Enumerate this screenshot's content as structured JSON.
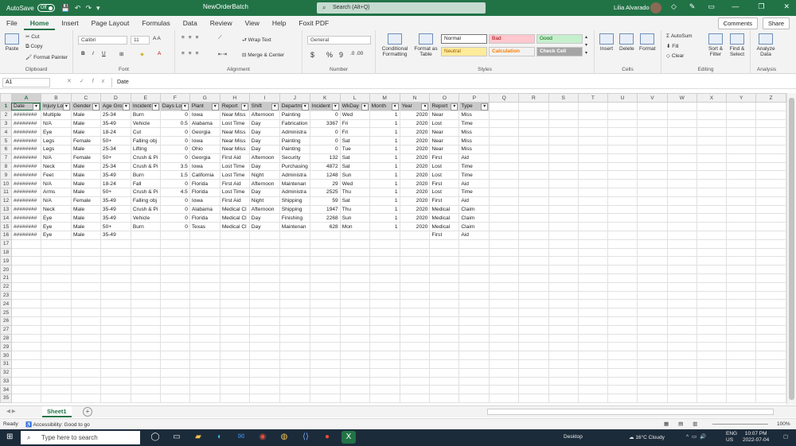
{
  "titlebar": {
    "autosave_label": "AutoSave",
    "autosave_state": "Off",
    "document_title": "NewOrderBatch",
    "search_placeholder": "Search (Alt+Q)",
    "user_name": "Lilia Alvarado"
  },
  "tabs": [
    "File",
    "Home",
    "Insert",
    "Page Layout",
    "Formulas",
    "Data",
    "Review",
    "View",
    "Help",
    "Foxit PDF"
  ],
  "active_tab": "Home",
  "tab_buttons": {
    "comments": "Comments",
    "share": "Share"
  },
  "ribbon": {
    "clipboard": {
      "label": "Clipboard",
      "paste": "Paste",
      "cut": "Cut",
      "copy": "Copy",
      "format_painter": "Format Painter"
    },
    "font": {
      "label": "Font",
      "family": "Calibri",
      "size": "11",
      "bold": "B",
      "italic": "I",
      "underline": "U"
    },
    "alignment": {
      "label": "Alignment",
      "wrap_text": "Wrap Text",
      "merge_center": "Merge & Center"
    },
    "number": {
      "label": "Number",
      "format": "General",
      "currency": "$",
      "percent": "%",
      "comma": "9"
    },
    "styles": {
      "label": "Styles",
      "conditional_formatting": "Conditional Formatting",
      "format_as_table": "Format as Table",
      "normal": "Normal",
      "bad": "Bad",
      "good": "Good",
      "neutral": "Neutral",
      "calculation": "Calculation",
      "check_cell": "Check Cell"
    },
    "cells": {
      "label": "Cells",
      "insert": "Insert",
      "delete": "Delete",
      "format": "Format"
    },
    "editing": {
      "label": "Editing",
      "autosum": "AutoSum",
      "fill": "Fill",
      "clear": "Clear",
      "sort_filter": "Sort & Filter",
      "find_select": "Find & Select"
    },
    "analysis": {
      "label": "Analysis",
      "analyze_data": "Analyze Data"
    }
  },
  "formula_bar": {
    "name_box": "A1",
    "content": "Date",
    "fx": "fx"
  },
  "sheet": {
    "columns": [
      "A",
      "B",
      "C",
      "D",
      "E",
      "F",
      "G",
      "H",
      "I",
      "J",
      "K",
      "L",
      "M",
      "N",
      "O",
      "P",
      "Q",
      "R",
      "S",
      "T",
      "U",
      "V",
      "W",
      "X",
      "Y",
      "Z"
    ],
    "selected_column": "A",
    "header": [
      "Date",
      "Injury Lo",
      "Gender",
      "Age Gro",
      "Incident",
      "Days Lo",
      "Plant",
      "Report",
      "Shift",
      "Departm",
      "Incident",
      "WkDay",
      "Month",
      "Year",
      "Report",
      "Type"
    ],
    "rows": [
      [
        "########",
        "Multiple",
        "Male",
        "25-34",
        "Burn",
        "0",
        "Iowa",
        "Near Miss",
        "Afternoon",
        "Painting",
        "0",
        "Wed",
        "1",
        "2020",
        "Near",
        "Miss"
      ],
      [
        "########",
        "N/A",
        "Male",
        "35-49",
        "Vehicle",
        "0.5",
        "Alabama",
        "Lost Time",
        "Day",
        "Fabrication",
        "3367",
        "Fri",
        "1",
        "2020",
        "Lost",
        "Time"
      ],
      [
        "########",
        "Eye",
        "Male",
        "18-24",
        "Cut",
        "0",
        "Georgia",
        "Near Miss",
        "Day",
        "Administra",
        "0",
        "Fri",
        "1",
        "2020",
        "Near",
        "Miss"
      ],
      [
        "########",
        "Legs",
        "Female",
        "50+",
        "Falling obj",
        "0",
        "Iowa",
        "Near Miss",
        "Day",
        "Painting",
        "0",
        "Sat",
        "1",
        "2020",
        "Near",
        "Miss"
      ],
      [
        "########",
        "Legs",
        "Male",
        "25-34",
        "Lifting",
        "0",
        "Ohio",
        "Near Miss",
        "Day",
        "Painting",
        "0",
        "Tue",
        "1",
        "2020",
        "Near",
        "Miss"
      ],
      [
        "########",
        "N/A",
        "Female",
        "50+",
        "Crush & Pi",
        "0",
        "Georgia",
        "First Aid",
        "Afternoon",
        "Security",
        "132",
        "Sat",
        "1",
        "2020",
        "First",
        "Aid"
      ],
      [
        "########",
        "Neck",
        "Male",
        "25-34",
        "Crush & Pi",
        "3.5",
        "Iowa",
        "Lost Time",
        "Day",
        "Purchasing",
        "4872",
        "Sat",
        "1",
        "2020",
        "Lost",
        "Time"
      ],
      [
        "########",
        "Feet",
        "Male",
        "35-49",
        "Burn",
        "1.5",
        "California",
        "Lost Time",
        "Night",
        "Administra",
        "1248",
        "Sun",
        "1",
        "2020",
        "Lost",
        "Time"
      ],
      [
        "########",
        "N/A",
        "Male",
        "18-24",
        "Fall",
        "0",
        "Florida",
        "First Aid",
        "Afternoon",
        "Maintenan",
        "29",
        "Wed",
        "1",
        "2020",
        "First",
        "Aid"
      ],
      [
        "########",
        "Arms",
        "Male",
        "50+",
        "Crush & Pi",
        "4.5",
        "Florida",
        "Lost Time",
        "Day",
        "Administra",
        "2525",
        "Thu",
        "1",
        "2020",
        "Lost",
        "Time"
      ],
      [
        "########",
        "N/A",
        "Female",
        "35-49",
        "Falling obj",
        "0",
        "Iowa",
        "First Aid",
        "Night",
        "Shipping",
        "59",
        "Sat",
        "1",
        "2020",
        "First",
        "Aid"
      ],
      [
        "########",
        "Neck",
        "Male",
        "35-49",
        "Crush & Pi",
        "0",
        "Alabama",
        "Medical Cl",
        "Afternoon",
        "Shipping",
        "1947",
        "Thu",
        "1",
        "2020",
        "Medical",
        "Claim"
      ],
      [
        "########",
        "Eye",
        "Male",
        "35-49",
        "Vehicle",
        "0",
        "Florida",
        "Medical Cl",
        "Day",
        "Finishing",
        "2268",
        "Sun",
        "1",
        "2020",
        "Medical",
        "Claim"
      ],
      [
        "########",
        "Eye",
        "Male",
        "50+",
        "Burn",
        "0",
        "Texas",
        "Medical Cl",
        "Day",
        "Maintenan",
        "628",
        "Mon",
        "1",
        "2020",
        "Medical",
        "Claim"
      ],
      [
        "########",
        "Eye",
        "Male",
        "35-49",
        "",
        "",
        "",
        "",
        "",
        "",
        "",
        "",
        "",
        "",
        "First",
        "Aid"
      ]
    ],
    "numeric_columns": [
      5,
      10,
      12,
      13
    ],
    "total_rows": 35
  },
  "sheet_tabs": [
    "Sheet1"
  ],
  "status": {
    "ready": "Ready",
    "accessibility": "Accessibility: Good to go",
    "zoom": "100%"
  },
  "taskbar": {
    "search_placeholder": "Type here to search",
    "desktop_label": "Desktop",
    "weather": "16°C  Cloudy",
    "lang": "ENG",
    "region": "US",
    "time": "10:07 PM",
    "date": "2022-07-04"
  },
  "colors": {
    "excel_green": "#217346",
    "header_fill": "#c9c9c9",
    "taskbar": "#1c2b3a"
  }
}
